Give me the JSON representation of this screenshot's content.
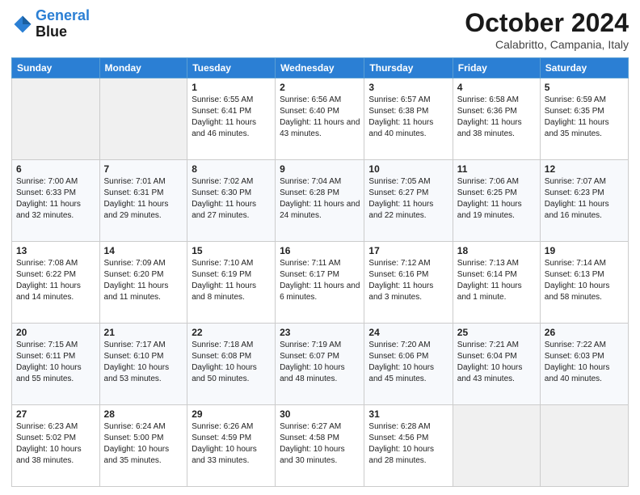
{
  "header": {
    "logo_line1": "General",
    "logo_line2": "Blue",
    "month": "October 2024",
    "location": "Calabritto, Campania, Italy"
  },
  "weekdays": [
    "Sunday",
    "Monday",
    "Tuesday",
    "Wednesday",
    "Thursday",
    "Friday",
    "Saturday"
  ],
  "weeks": [
    [
      {
        "day": "",
        "sunrise": "",
        "sunset": "",
        "daylight": ""
      },
      {
        "day": "",
        "sunrise": "",
        "sunset": "",
        "daylight": ""
      },
      {
        "day": "1",
        "sunrise": "Sunrise: 6:55 AM",
        "sunset": "Sunset: 6:41 PM",
        "daylight": "Daylight: 11 hours and 46 minutes."
      },
      {
        "day": "2",
        "sunrise": "Sunrise: 6:56 AM",
        "sunset": "Sunset: 6:40 PM",
        "daylight": "Daylight: 11 hours and 43 minutes."
      },
      {
        "day": "3",
        "sunrise": "Sunrise: 6:57 AM",
        "sunset": "Sunset: 6:38 PM",
        "daylight": "Daylight: 11 hours and 40 minutes."
      },
      {
        "day": "4",
        "sunrise": "Sunrise: 6:58 AM",
        "sunset": "Sunset: 6:36 PM",
        "daylight": "Daylight: 11 hours and 38 minutes."
      },
      {
        "day": "5",
        "sunrise": "Sunrise: 6:59 AM",
        "sunset": "Sunset: 6:35 PM",
        "daylight": "Daylight: 11 hours and 35 minutes."
      }
    ],
    [
      {
        "day": "6",
        "sunrise": "Sunrise: 7:00 AM",
        "sunset": "Sunset: 6:33 PM",
        "daylight": "Daylight: 11 hours and 32 minutes."
      },
      {
        "day": "7",
        "sunrise": "Sunrise: 7:01 AM",
        "sunset": "Sunset: 6:31 PM",
        "daylight": "Daylight: 11 hours and 29 minutes."
      },
      {
        "day": "8",
        "sunrise": "Sunrise: 7:02 AM",
        "sunset": "Sunset: 6:30 PM",
        "daylight": "Daylight: 11 hours and 27 minutes."
      },
      {
        "day": "9",
        "sunrise": "Sunrise: 7:04 AM",
        "sunset": "Sunset: 6:28 PM",
        "daylight": "Daylight: 11 hours and 24 minutes."
      },
      {
        "day": "10",
        "sunrise": "Sunrise: 7:05 AM",
        "sunset": "Sunset: 6:27 PM",
        "daylight": "Daylight: 11 hours and 22 minutes."
      },
      {
        "day": "11",
        "sunrise": "Sunrise: 7:06 AM",
        "sunset": "Sunset: 6:25 PM",
        "daylight": "Daylight: 11 hours and 19 minutes."
      },
      {
        "day": "12",
        "sunrise": "Sunrise: 7:07 AM",
        "sunset": "Sunset: 6:23 PM",
        "daylight": "Daylight: 11 hours and 16 minutes."
      }
    ],
    [
      {
        "day": "13",
        "sunrise": "Sunrise: 7:08 AM",
        "sunset": "Sunset: 6:22 PM",
        "daylight": "Daylight: 11 hours and 14 minutes."
      },
      {
        "day": "14",
        "sunrise": "Sunrise: 7:09 AM",
        "sunset": "Sunset: 6:20 PM",
        "daylight": "Daylight: 11 hours and 11 minutes."
      },
      {
        "day": "15",
        "sunrise": "Sunrise: 7:10 AM",
        "sunset": "Sunset: 6:19 PM",
        "daylight": "Daylight: 11 hours and 8 minutes."
      },
      {
        "day": "16",
        "sunrise": "Sunrise: 7:11 AM",
        "sunset": "Sunset: 6:17 PM",
        "daylight": "Daylight: 11 hours and 6 minutes."
      },
      {
        "day": "17",
        "sunrise": "Sunrise: 7:12 AM",
        "sunset": "Sunset: 6:16 PM",
        "daylight": "Daylight: 11 hours and 3 minutes."
      },
      {
        "day": "18",
        "sunrise": "Sunrise: 7:13 AM",
        "sunset": "Sunset: 6:14 PM",
        "daylight": "Daylight: 11 hours and 1 minute."
      },
      {
        "day": "19",
        "sunrise": "Sunrise: 7:14 AM",
        "sunset": "Sunset: 6:13 PM",
        "daylight": "Daylight: 10 hours and 58 minutes."
      }
    ],
    [
      {
        "day": "20",
        "sunrise": "Sunrise: 7:15 AM",
        "sunset": "Sunset: 6:11 PM",
        "daylight": "Daylight: 10 hours and 55 minutes."
      },
      {
        "day": "21",
        "sunrise": "Sunrise: 7:17 AM",
        "sunset": "Sunset: 6:10 PM",
        "daylight": "Daylight: 10 hours and 53 minutes."
      },
      {
        "day": "22",
        "sunrise": "Sunrise: 7:18 AM",
        "sunset": "Sunset: 6:08 PM",
        "daylight": "Daylight: 10 hours and 50 minutes."
      },
      {
        "day": "23",
        "sunrise": "Sunrise: 7:19 AM",
        "sunset": "Sunset: 6:07 PM",
        "daylight": "Daylight: 10 hours and 48 minutes."
      },
      {
        "day": "24",
        "sunrise": "Sunrise: 7:20 AM",
        "sunset": "Sunset: 6:06 PM",
        "daylight": "Daylight: 10 hours and 45 minutes."
      },
      {
        "day": "25",
        "sunrise": "Sunrise: 7:21 AM",
        "sunset": "Sunset: 6:04 PM",
        "daylight": "Daylight: 10 hours and 43 minutes."
      },
      {
        "day": "26",
        "sunrise": "Sunrise: 7:22 AM",
        "sunset": "Sunset: 6:03 PM",
        "daylight": "Daylight: 10 hours and 40 minutes."
      }
    ],
    [
      {
        "day": "27",
        "sunrise": "Sunrise: 6:23 AM",
        "sunset": "Sunset: 5:02 PM",
        "daylight": "Daylight: 10 hours and 38 minutes."
      },
      {
        "day": "28",
        "sunrise": "Sunrise: 6:24 AM",
        "sunset": "Sunset: 5:00 PM",
        "daylight": "Daylight: 10 hours and 35 minutes."
      },
      {
        "day": "29",
        "sunrise": "Sunrise: 6:26 AM",
        "sunset": "Sunset: 4:59 PM",
        "daylight": "Daylight: 10 hours and 33 minutes."
      },
      {
        "day": "30",
        "sunrise": "Sunrise: 6:27 AM",
        "sunset": "Sunset: 4:58 PM",
        "daylight": "Daylight: 10 hours and 30 minutes."
      },
      {
        "day": "31",
        "sunrise": "Sunrise: 6:28 AM",
        "sunset": "Sunset: 4:56 PM",
        "daylight": "Daylight: 10 hours and 28 minutes."
      },
      {
        "day": "",
        "sunrise": "",
        "sunset": "",
        "daylight": ""
      },
      {
        "day": "",
        "sunrise": "",
        "sunset": "",
        "daylight": ""
      }
    ]
  ]
}
